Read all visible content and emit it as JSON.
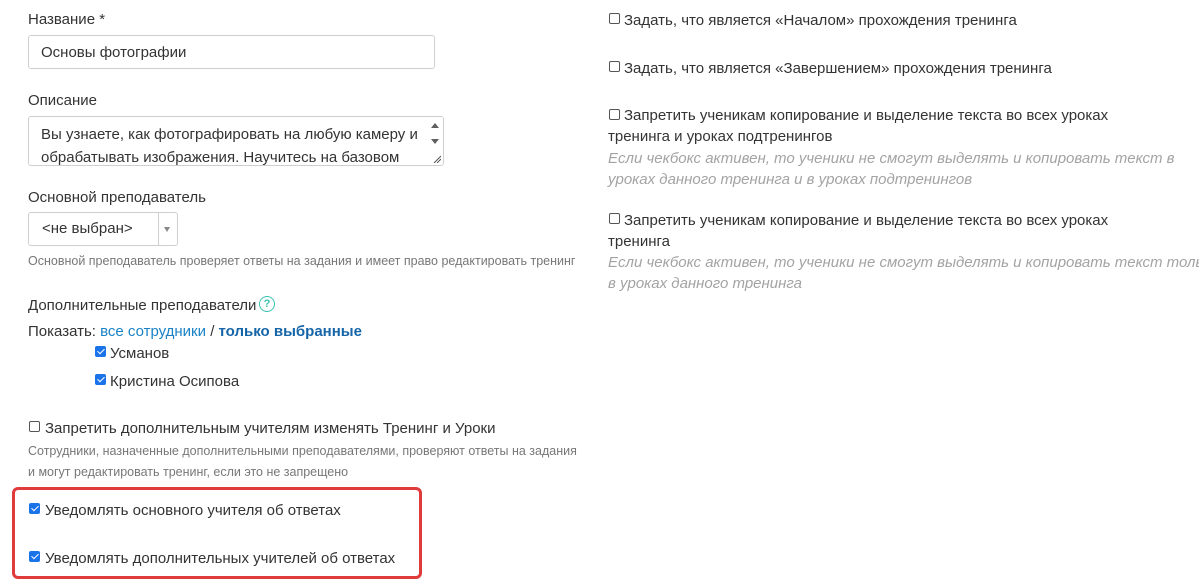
{
  "name": {
    "label": "Название *",
    "value": "Основы фотографии"
  },
  "description": {
    "label": "Описание",
    "line1": "Вы узнаете, как фотографировать на любую камеру и",
    "line2": "обрабатывать изображения. Научитесь на базовом"
  },
  "main_teacher": {
    "label": "Основной преподаватель",
    "selected": "<не выбран>",
    "hint": "Основной преподаватель проверяет ответы на задания и имеет право редактировать тренинг"
  },
  "extra_teachers": {
    "label": "Дополнительные преподаватели",
    "help_glyph": "?",
    "show_label": "Показать:",
    "filter_all": "все сотрудники",
    "separator": "/",
    "filter_selected": "только выбранные",
    "teachers": [
      {
        "name": "Усманов",
        "checked": true
      },
      {
        "name": "Кристина Осипова",
        "checked": true
      }
    ]
  },
  "forbid_extra": {
    "label": "Запретить дополнительным учителям изменять Тренинг и Уроки",
    "checked": false,
    "hint_line1": "Сотрудники, назначенные дополнительными преподавателями, проверяют ответы на задания",
    "hint_line2": "и могут редактировать тренинг, если это не запрещено"
  },
  "notify": {
    "main_label": "Уведомлять основного учителя об ответах",
    "main_checked": true,
    "extra_label": "Уведомлять дополнительных учителей об ответах",
    "extra_checked": true
  },
  "right": {
    "start_label": "Задать, что является «Началом» прохождения тренинга",
    "end_label": "Задать, что является «Завершением» прохождения тренинга",
    "copy_all_line1": "Запретить ученикам копирование и выделение текста во всех уроках",
    "copy_all_line2": "тренинга и уроках подтренингов",
    "copy_all_hint1": "Если чекбокс активен, то ученики не смогут выделять и копировать текст в",
    "copy_all_hint2": "уроках данного тренинга и в уроках подтренингов",
    "copy_one_line1": "Запретить ученикам копирование и выделение текста во всех уроках",
    "copy_one_line2": "тренинга",
    "copy_one_hint1": "Если чекбокс активен, то ученики не смогут выделять и копировать текст только",
    "copy_one_hint2": "в уроках данного тренинга"
  },
  "colors": {
    "highlight": "#e03b3b",
    "checkbox_checked": "#1a73e8",
    "link": "#1a82c5",
    "help_icon": "#3cc2b0"
  }
}
